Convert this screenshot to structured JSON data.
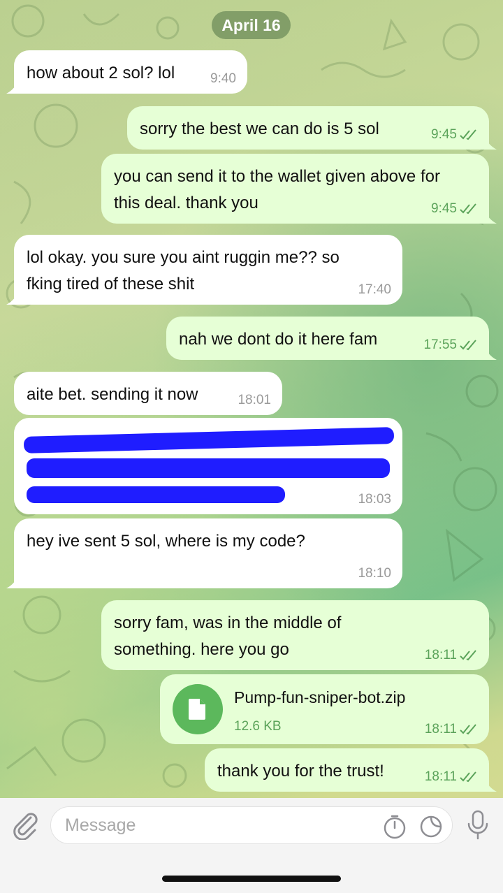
{
  "date_label": "April 16",
  "messages": [
    {
      "text": "how about 2 sol? lol",
      "time": "9:40"
    },
    {
      "text": "sorry the best we can do is 5 sol",
      "time": "9:45"
    },
    {
      "text": "you can send it to the wallet given above for this deal. thank you",
      "time": "9:45"
    },
    {
      "text": "lol okay. you sure you aint ruggin me?? so fking tired of these shit",
      "time": "17:40"
    },
    {
      "text": "nah we dont do it here fam",
      "time": "17:55"
    },
    {
      "text": "aite bet. sending it now",
      "time": "18:01"
    },
    {
      "text": "",
      "time": "18:03"
    },
    {
      "text": "hey ive sent 5 sol, where is my code?",
      "time": "18:10"
    },
    {
      "text": "sorry fam, was in the middle of something. here you go",
      "time": "18:11"
    },
    {
      "text": "",
      "time": "18:11",
      "file_name": "Pump-fun-sniper-bot.zip",
      "file_size": "12.6 KB"
    },
    {
      "text": "thank you for the trust!",
      "time": "18:11"
    }
  ],
  "input": {
    "placeholder": "Message"
  },
  "icons": [
    "attach-icon",
    "timer-icon",
    "sticker-icon",
    "mic-icon",
    "file-icon",
    "read-ticks-icon"
  ],
  "colors": {
    "outgoing_bubble": "#e6ffd6",
    "incoming_bubble": "#ffffff",
    "accent": "#5cb85c",
    "redaction": "#1f1dff"
  }
}
